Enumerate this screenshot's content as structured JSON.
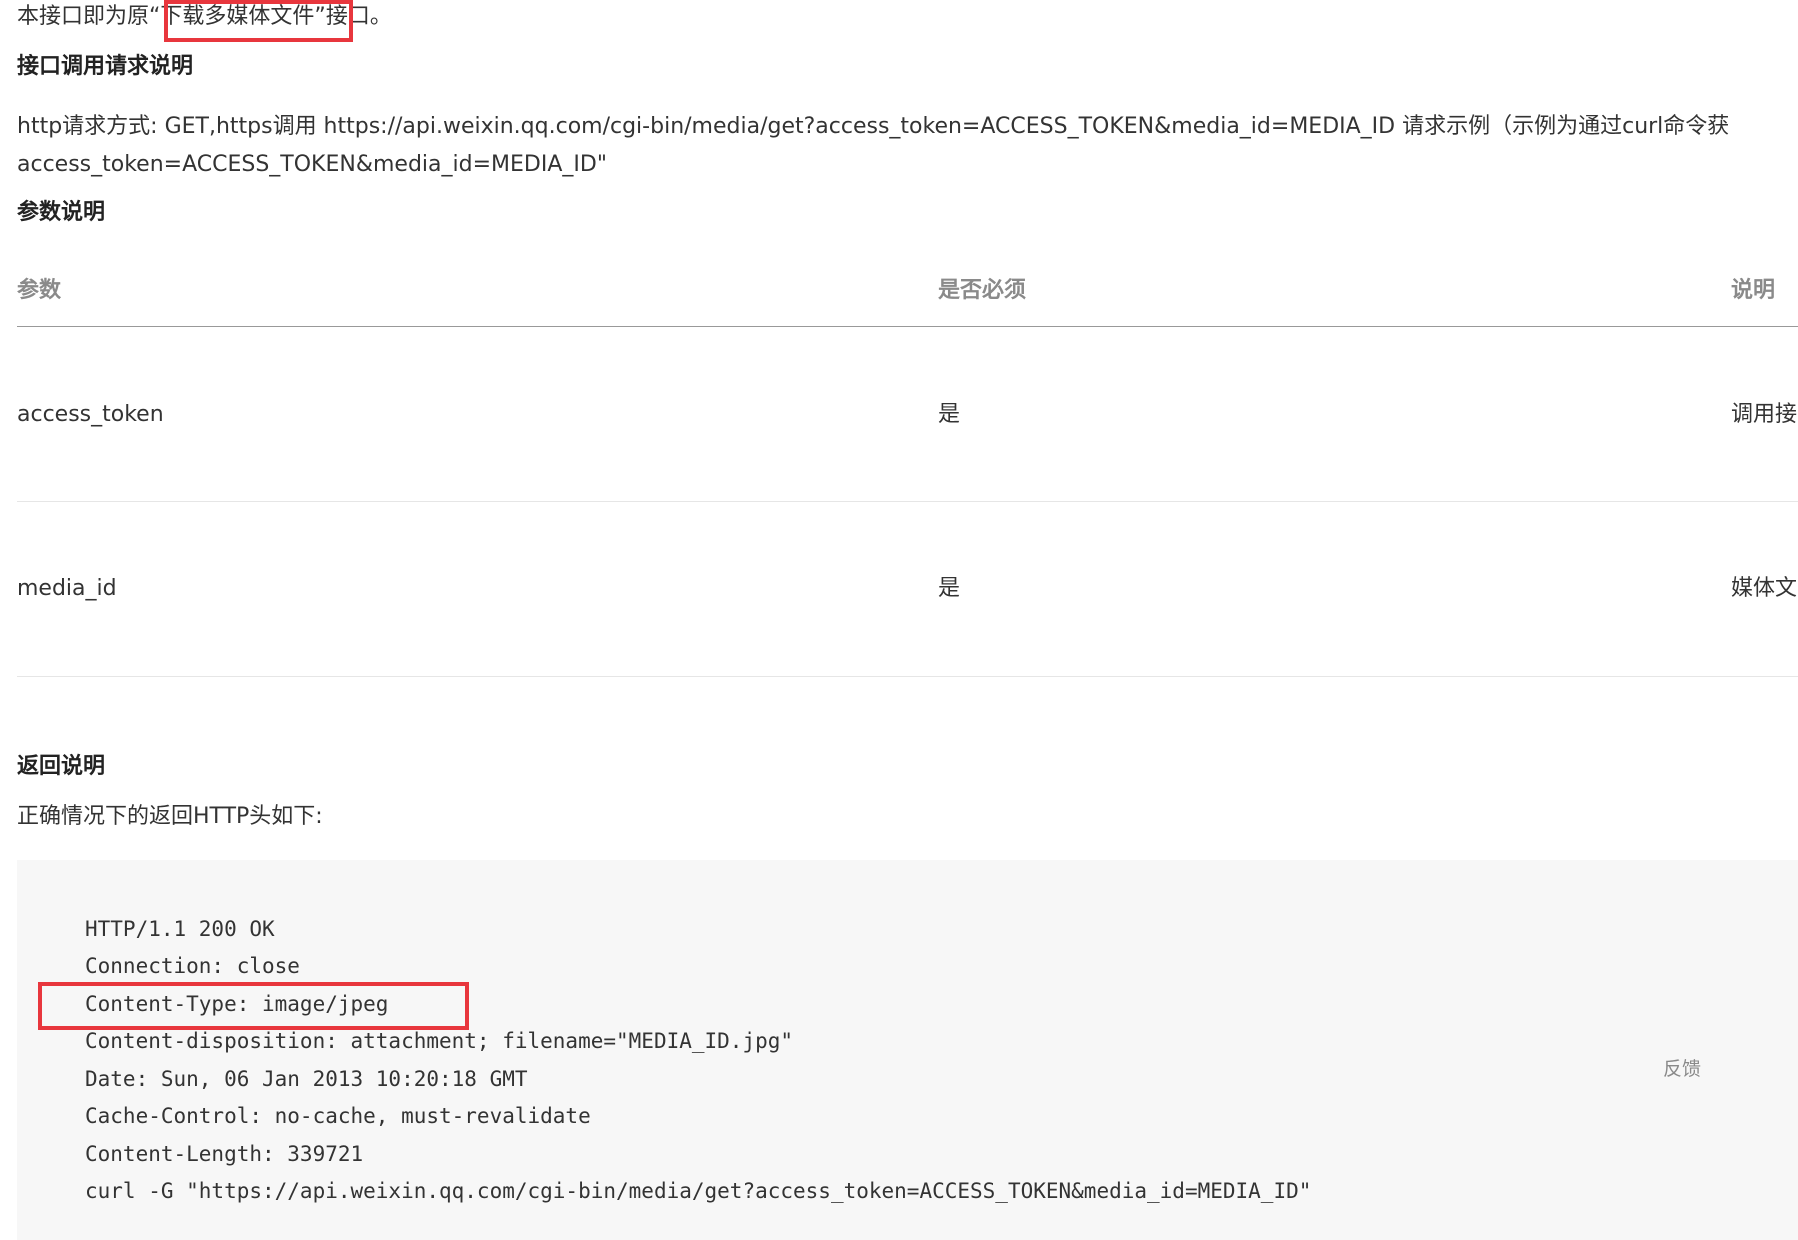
{
  "intro": {
    "prefix": "本接口即为原“",
    "highlight": "下载多媒体文件",
    "suffix": "”接口。"
  },
  "request": {
    "heading": "接口调用请求说明",
    "line1": "http请求方式: GET,https调用 https://api.weixin.qq.com/cgi-bin/media/get?access_token=ACCESS_TOKEN&media_id=MEDIA_ID 请求示例（示例为通过curl命令获",
    "line2": "access_token=ACCESS_TOKEN&media_id=MEDIA_ID\""
  },
  "params": {
    "heading": "参数说明",
    "columns": [
      "参数",
      "是否必须",
      "说明"
    ],
    "rows": [
      {
        "param": "access_token",
        "required": "是",
        "desc": "调用接"
      },
      {
        "param": "media_id",
        "required": "是",
        "desc": "媒体文"
      }
    ]
  },
  "response": {
    "heading": "返回说明",
    "subtitle": "正确情况下的返回HTTP头如下:",
    "code_lines": [
      "HTTP/1.1 200 OK",
      "Connection: close",
      "Content-Type: image/jpeg",
      "Content-disposition: attachment; filename=\"MEDIA_ID.jpg\"",
      "Date: Sun, 06 Jan 2013 10:20:18 GMT",
      "Cache-Control: no-cache, must-revalidate",
      "Content-Length: 339721",
      "curl -G \"https://api.weixin.qq.com/cgi-bin/media/get?access_token=ACCESS_TOKEN&media_id=MEDIA_ID\""
    ]
  },
  "feedback": {
    "label": "反馈"
  },
  "colors": {
    "highlight_border": "#e8363d",
    "code_background": "#f7f7f7",
    "header_text": "#8a8a8a"
  }
}
